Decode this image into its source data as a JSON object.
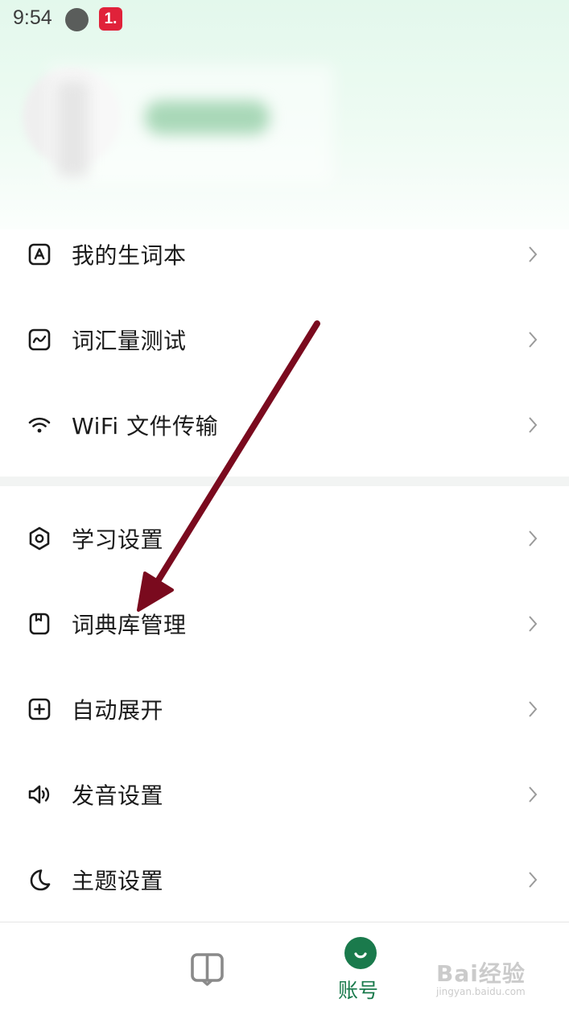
{
  "status_bar": {
    "time": "9:54",
    "notification_badge": "1."
  },
  "menu_group_1": [
    {
      "label": "我的生词本",
      "icon": "vocab-book-icon"
    },
    {
      "label": "词汇量测试",
      "icon": "chart-test-icon"
    },
    {
      "label": "WiFi 文件传输",
      "icon": "wifi-icon"
    }
  ],
  "menu_group_2": [
    {
      "label": "学习设置",
      "icon": "hexagon-settings-icon"
    },
    {
      "label": "词典库管理",
      "icon": "bookmark-icon"
    },
    {
      "label": "自动展开",
      "icon": "plus-square-icon"
    },
    {
      "label": "发音设置",
      "icon": "speaker-icon"
    },
    {
      "label": "主题设置",
      "icon": "moon-icon"
    }
  ],
  "bottom_nav": {
    "account_label": "账号"
  },
  "watermark": {
    "brand": "Bai经验",
    "url": "jingyan.baidu.com"
  },
  "colors": {
    "accent": "#1a7a4c",
    "annotation_arrow": "#7a0a1e"
  }
}
